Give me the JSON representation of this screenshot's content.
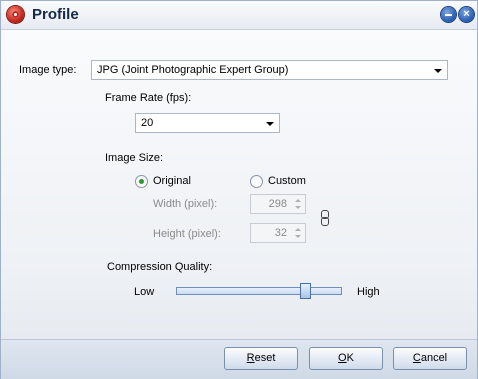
{
  "window": {
    "title": "Profile"
  },
  "image_type": {
    "label": "Image type:",
    "value": "JPG (Joint Photographic Expert Group)"
  },
  "frame_rate": {
    "label": "Frame Rate (fps):",
    "value": "20"
  },
  "image_size": {
    "label": "Image Size:",
    "original_label": "Original",
    "custom_label": "Custom",
    "selected": "Original",
    "width_label": "Width (pixel):",
    "width_value": "298",
    "height_label": "Height (pixel):",
    "height_value": "32"
  },
  "compression": {
    "label": "Compression Quality:",
    "low_label": "Low",
    "high_label": "High",
    "level_fraction": 0.8
  },
  "buttons": {
    "reset_u": "R",
    "reset_rest": "eset",
    "ok_u": "O",
    "ok_rest": "K",
    "cancel_u": "C",
    "cancel_rest": "ancel"
  },
  "icons": {
    "app": "profile-gear-icon",
    "minimize": "minimize-icon",
    "close": "close-icon",
    "link": "chain-link-icon"
  }
}
